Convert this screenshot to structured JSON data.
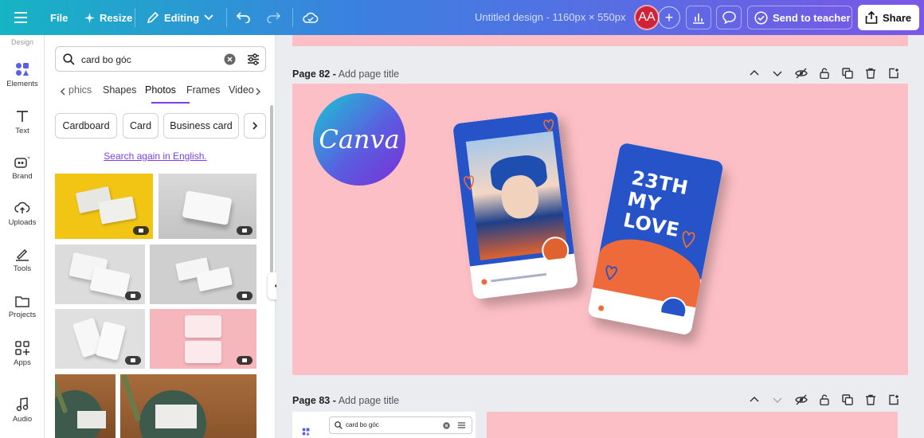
{
  "topbar": {
    "file_label": "File",
    "resize_label": "Resize",
    "editing_label": "Editing",
    "document_title": "Untitled design - 1160px × 550px",
    "avatar_initials": "AA",
    "send_label": "Send to teacher",
    "share_label": "Share"
  },
  "rail": {
    "items": [
      {
        "label": "Design",
        "icon": "design-icon"
      },
      {
        "label": "Elements",
        "icon": "elements-icon"
      },
      {
        "label": "Text",
        "icon": "text-icon"
      },
      {
        "label": "Brand",
        "icon": "brand-icon"
      },
      {
        "label": "Uploads",
        "icon": "uploads-icon"
      },
      {
        "label": "Tools",
        "icon": "tools-icon"
      },
      {
        "label": "Projects",
        "icon": "projects-icon"
      },
      {
        "label": "Apps",
        "icon": "apps-icon"
      },
      {
        "label": "Audio",
        "icon": "audio-icon"
      }
    ]
  },
  "panel": {
    "search_value": "card bo góc",
    "tabs": [
      "phics",
      "Shapes",
      "Photos",
      "Frames",
      "Video"
    ],
    "active_tab": "Photos",
    "chips": [
      "Cardboard",
      "Card",
      "Business card"
    ],
    "search_again": "Search again in English."
  },
  "pages": {
    "page82_number": "Page 82 -",
    "page82_title": "Add page title",
    "page83_number": "Page 83 -",
    "page83_title": "Add page title"
  },
  "design": {
    "logo_text": "Canva",
    "card2_text": [
      "23TH",
      "MY",
      "LOVE"
    ]
  },
  "thumbnail": {
    "search_value": "card bo góc"
  },
  "colors": {
    "accent": "#7a40e6",
    "page_bg": "#fcbfc5",
    "card_blue": "#2654c8",
    "card_orange": "#ef6a3a"
  }
}
